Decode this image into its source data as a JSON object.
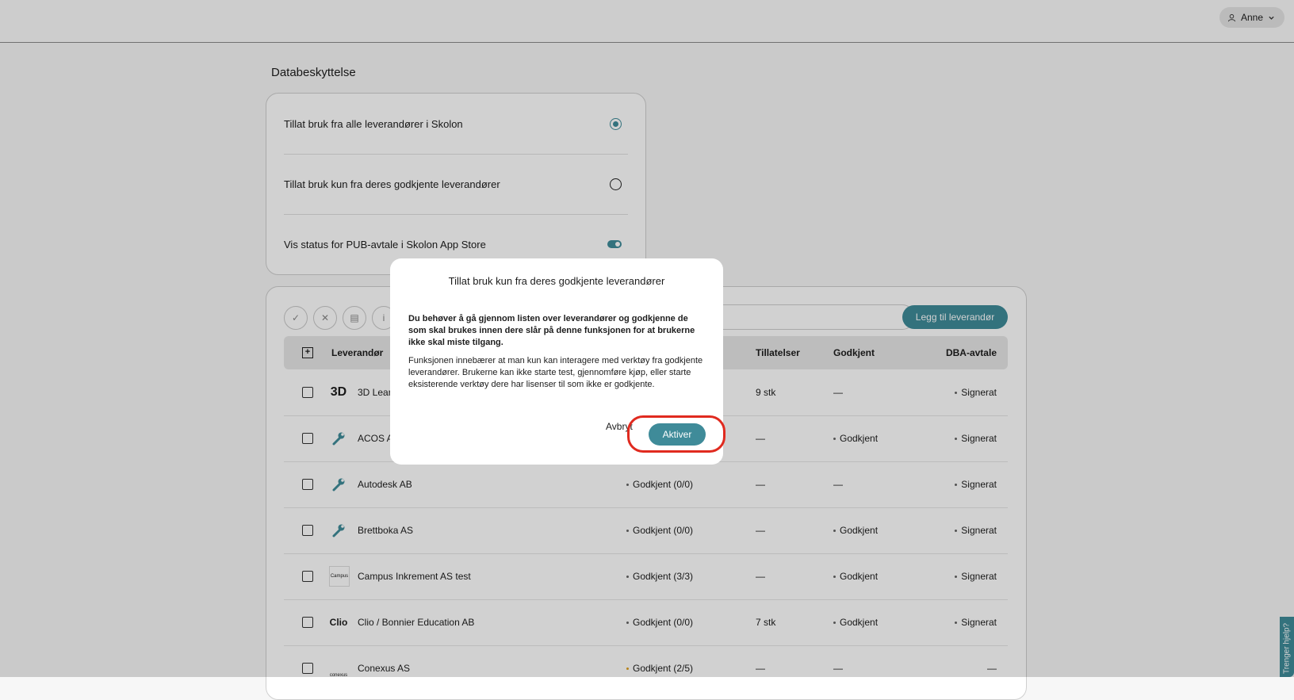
{
  "header": {
    "user_name": "Anne"
  },
  "page": {
    "title": "Databeskyttelse"
  },
  "settings": {
    "option_all": "Tillat bruk fra alle leverandører i Skolon",
    "option_approved": "Tillat bruk kun fra deres godkjente leverandører",
    "option_pub_status": "Vis status for PUB-avtale i Skolon App Store"
  },
  "toolbar": {
    "add_supplier": "Legg til leverandør"
  },
  "table": {
    "headers": {
      "supplier": "Leverandør",
      "permissions": "Tillatelser",
      "approved": "Godkjent",
      "dba": "DBA-avtale"
    },
    "rows": [
      {
        "name": "3D Learn",
        "status": "",
        "permissions": "9 stk",
        "approved": "—",
        "dba": "Signerat",
        "logo": "3D"
      },
      {
        "name": "ACOS A",
        "status": "",
        "permissions": "—",
        "approved": "Godkjent",
        "dba": "Signerat",
        "logo": "wrench-icon"
      },
      {
        "name": "Autodesk AB",
        "status": "Godkjent (0/0)",
        "permissions": "—",
        "approved": "—",
        "dba": "Signerat",
        "logo": "wrench-icon"
      },
      {
        "name": "Brettboka AS",
        "status": "Godkjent (0/0)",
        "permissions": "—",
        "approved": "Godkjent",
        "dba": "Signerat",
        "logo": "wrench-icon"
      },
      {
        "name": "Campus Inkrement AS test",
        "status": "Godkjent (3/3)",
        "permissions": "—",
        "approved": "Godkjent",
        "dba": "Signerat",
        "logo": "Campus"
      },
      {
        "name": "Clio / Bonnier Education AB",
        "status": "Godkjent (0/0)",
        "permissions": "7 stk",
        "approved": "Godkjent",
        "dba": "Signerat",
        "logo": "Clio"
      },
      {
        "name": "Conexus AS",
        "status": "Godkjent (2/5)",
        "permissions": "—",
        "approved": "—",
        "dba": "—",
        "logo": "conexus"
      }
    ]
  },
  "modal": {
    "title": "Tillat bruk kun fra deres godkjente leverandører",
    "bold_text": "Du behøver å gå gjennom listen over leverandører og godkjenne de som skal brukes innen dere slår på denne funksjonen for at brukerne ikke skal miste tilgang.",
    "body_text": "Funksjonen innebærer at man kun kan interagere med verktøy fra godkjente leverandører. Brukerne kan ikke starte test, gjennomføre kjøp, eller starte eksisterende verktøy dere har lisenser til som ikke er godkjente.",
    "cancel_label": "Avbryt",
    "confirm_label": "Aktiver"
  },
  "help_tab": {
    "label": "Trenger hjelp?"
  },
  "colors": {
    "accent": "#3f8b99",
    "highlight": "#e02a1f"
  }
}
